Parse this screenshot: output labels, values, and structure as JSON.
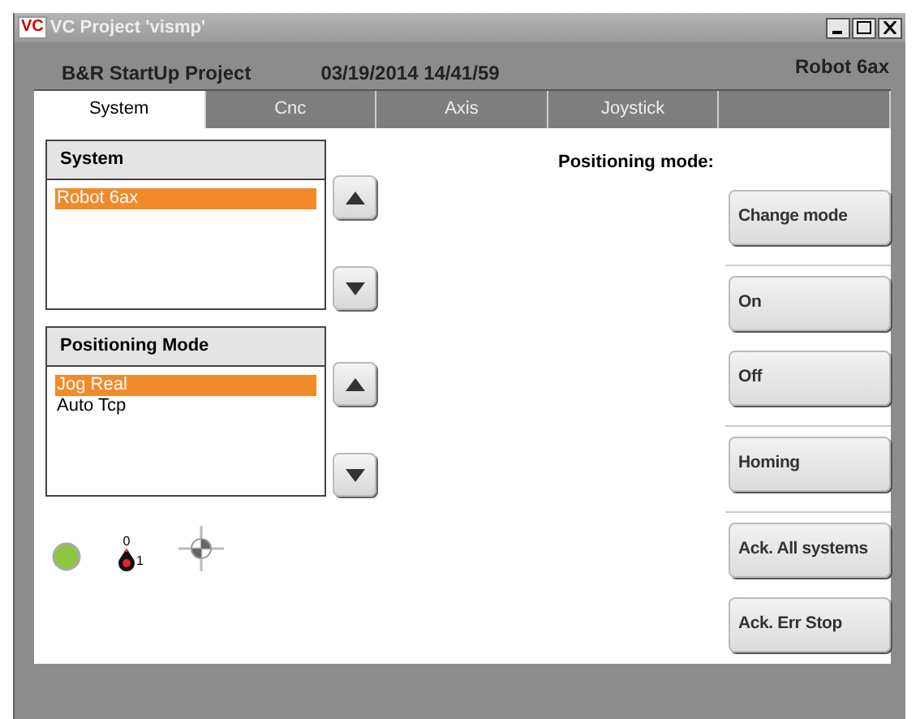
{
  "window": {
    "title": "VC Project 'vismp'",
    "logo": "VC"
  },
  "header": {
    "project": "B&R StartUp Project",
    "datetime": "03/19/2014 14/41/59",
    "robot": "Robot 6ax"
  },
  "tabs": [
    {
      "label": "System",
      "selected": true
    },
    {
      "label": "Cnc",
      "selected": false
    },
    {
      "label": "Axis",
      "selected": false
    },
    {
      "label": "Joystick",
      "selected": false
    },
    {
      "selected": false
    }
  ],
  "lists": [
    {
      "title": "System",
      "items": [
        {
          "label": "Robot 6ax",
          "selected": true
        }
      ]
    },
    {
      "title": "Positioning Mode",
      "items": [
        {
          "label": "Jog Real",
          "selected": true
        },
        {
          "label": "Auto Tcp",
          "selected": false
        }
      ]
    }
  ],
  "switch": {
    "off_label": "0",
    "on_label": "1"
  },
  "mode_label": "Positioning mode:",
  "buttons": [
    {
      "label": "Change mode",
      "divider_after": true
    },
    {
      "label": "On",
      "divider_after": false
    },
    {
      "label": "Off",
      "divider_after": true
    },
    {
      "label": "Homing",
      "divider_after": true
    },
    {
      "label": "Ack. All systems",
      "divider_after": false
    },
    {
      "label": "Ack. Err Stop",
      "divider_after": false
    }
  ]
}
